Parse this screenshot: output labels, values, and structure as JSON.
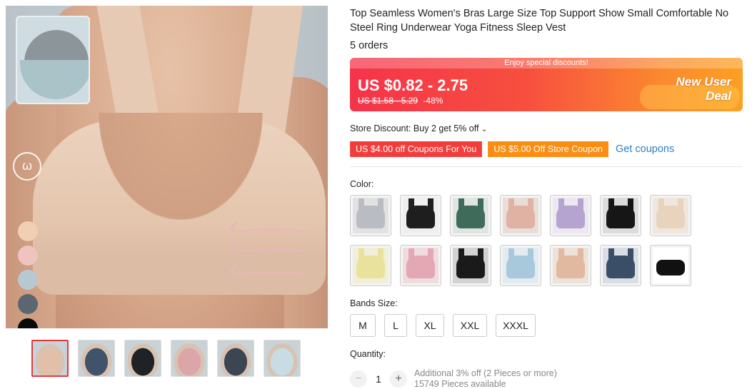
{
  "product": {
    "title": "Top Seamless Women's Bras Large Size Top Support Show Small Comfortable No Steel Ring Underwear Yoga Fitness Sleep Vest",
    "orders": "5 orders"
  },
  "price": {
    "banner": "Enjoy special discounts!",
    "range": "US $0.82 - 2.75",
    "original": "US $1.58 - 5.29",
    "discount": "-48%",
    "deal_line1": "New User",
    "deal_line2": "Deal"
  },
  "store_discount": "Store Discount: Buy 2 get 5% off",
  "coupons": {
    "red": "US $4.00 off Coupons For You",
    "orange": "US $5.00 Off Store Coupon",
    "link": "Get coupons"
  },
  "color_label": "Color:",
  "colors": [
    {
      "name": "grey",
      "body": "#b9bcc2",
      "bg": "#e2e2e2"
    },
    {
      "name": "black",
      "body": "#1e1e1e",
      "bg": "#efefef"
    },
    {
      "name": "dark-green",
      "body": "#3e6b5a",
      "bg": "#dfe6e2"
    },
    {
      "name": "pink-nude",
      "body": "#dfb2a3",
      "bg": "#e8ddd8"
    },
    {
      "name": "lilac",
      "body": "#b5a4cf",
      "bg": "#ece7f1"
    },
    {
      "name": "black-2",
      "body": "#161616",
      "bg": "#dcdcdc"
    },
    {
      "name": "beige",
      "body": "#e8d4bd",
      "bg": "#efe7de"
    },
    {
      "name": "yellow",
      "body": "#e9e29c",
      "bg": "#f1efd9"
    },
    {
      "name": "pink",
      "body": "#e3a8b4",
      "bg": "#efdcdf"
    },
    {
      "name": "black-3",
      "body": "#1a1a1a",
      "bg": "#d3d3d3"
    },
    {
      "name": "light-blue",
      "body": "#a8c9db",
      "bg": "#e1ebf0"
    },
    {
      "name": "nude",
      "body": "#e0b9a0",
      "bg": "#ece2d8"
    },
    {
      "name": "navy",
      "body": "#3b4e67",
      "bg": "#d9dee4"
    },
    {
      "name": "black-bandeau",
      "body": "#111111",
      "bg": "#ffffff"
    }
  ],
  "size_label": "Bands Size:",
  "sizes": [
    "M",
    "L",
    "XL",
    "XXL",
    "XXXL"
  ],
  "quantity": {
    "label": "Quantity:",
    "value": "1",
    "minus": "−",
    "plus": "+",
    "note1": "Additional 3% off (2 Pieces or more)",
    "note2": "15749 Pieces available"
  },
  "swatch_colors": [
    "#f2cfb2",
    "#efc3bf",
    "#b8c8d2",
    "#5b6670",
    "#0a0a0a"
  ],
  "thumbnails": [
    {
      "name": "nude",
      "color": "#e2bfa8"
    },
    {
      "name": "navy",
      "color": "#41536a"
    },
    {
      "name": "black",
      "color": "#1f2326"
    },
    {
      "name": "pink",
      "color": "#dca6a8"
    },
    {
      "name": "navy-back",
      "color": "#3c4552"
    },
    {
      "name": "detail",
      "color": "#c7dce3"
    }
  ]
}
